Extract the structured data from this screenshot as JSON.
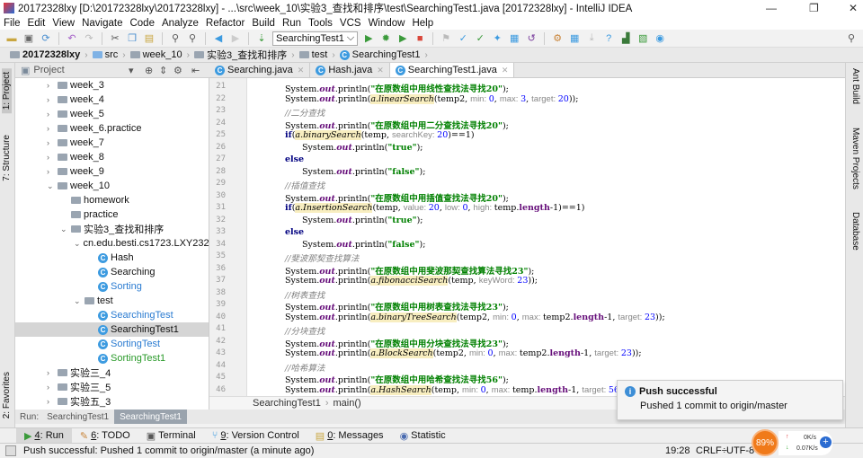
{
  "window": {
    "title": "20172328lxy [D:\\20172328lxy\\20172328lxy] - ...\\src\\week_10\\实验3_查找和排序\\test\\SearchingTest1.java [20172328lxy] - IntelliJ IDEA",
    "minimize": "—",
    "maximize": "❐",
    "close": "✕"
  },
  "menu": [
    "File",
    "Edit",
    "View",
    "Navigate",
    "Code",
    "Analyze",
    "Refactor",
    "Build",
    "Run",
    "Tools",
    "VCS",
    "Window",
    "Help"
  ],
  "toolbar": {
    "run_config": "SearchingTest1",
    "run_config_arrow": "⌵"
  },
  "navbar": [
    "20172328lxy",
    "src",
    "week_10",
    "实验3_查找和排序",
    "test",
    "SearchingTest1"
  ],
  "left_strip": {
    "project": "1: Project",
    "structure": "7: Structure",
    "favorites": "2: Favorites"
  },
  "right_strip": {
    "ant": "Ant Build",
    "maven": "Maven Projects",
    "database": "Database"
  },
  "project_panel": {
    "title": "Project",
    "dropdown": "▾"
  },
  "tree": [
    {
      "label": "week_3",
      "level": 0,
      "type": "folder",
      "arrow": "›"
    },
    {
      "label": "week_4",
      "level": 0,
      "type": "folder",
      "arrow": "›"
    },
    {
      "label": "week_5",
      "level": 0,
      "type": "folder",
      "arrow": "›"
    },
    {
      "label": "week_6.practice",
      "level": 0,
      "type": "folder",
      "arrow": "›"
    },
    {
      "label": "week_7",
      "level": 0,
      "type": "folder",
      "arrow": "›"
    },
    {
      "label": "week_8",
      "level": 0,
      "type": "folder",
      "arrow": "›"
    },
    {
      "label": "week_9",
      "level": 0,
      "type": "folder",
      "arrow": "›"
    },
    {
      "label": "week_10",
      "level": 0,
      "type": "folder",
      "arrow": "⌄"
    },
    {
      "label": "homework",
      "level": 1,
      "type": "folder",
      "arrow": ""
    },
    {
      "label": "practice",
      "level": 1,
      "type": "folder",
      "arrow": ""
    },
    {
      "label": "实验3_查找和排序",
      "level": 1,
      "type": "folder",
      "arrow": "⌄"
    },
    {
      "label": "cn.edu.besti.cs1723.LXY2328",
      "level": 2,
      "type": "folder",
      "arrow": "⌄"
    },
    {
      "label": "Hash",
      "level": 3,
      "type": "class",
      "arrow": ""
    },
    {
      "label": "Searching",
      "level": 3,
      "type": "class",
      "arrow": ""
    },
    {
      "label": "Sorting",
      "level": 3,
      "type": "class",
      "arrow": "",
      "color": "#2a7bd1"
    },
    {
      "label": "test",
      "level": 2,
      "type": "folder",
      "arrow": "⌄"
    },
    {
      "label": "SearchingTest",
      "level": 3,
      "type": "class",
      "arrow": "",
      "color": "#2a7bd1"
    },
    {
      "label": "SearchingTest1",
      "level": 3,
      "type": "class",
      "arrow": "",
      "selected": true
    },
    {
      "label": "SortingTest",
      "level": 3,
      "type": "class",
      "arrow": "",
      "color": "#2a7bd1"
    },
    {
      "label": "SortingTest1",
      "level": 3,
      "type": "class",
      "arrow": "",
      "color": "#2a9a2a"
    },
    {
      "label": "实验三_4",
      "level": -1,
      "type": "folder",
      "arrow": "›"
    },
    {
      "label": "实验三_5",
      "level": -1,
      "type": "folder",
      "arrow": "›"
    },
    {
      "label": "实验五_3",
      "level": -1,
      "type": "folder",
      "arrow": "›"
    }
  ],
  "editor_tabs": [
    {
      "label": "Searching.java",
      "active": false
    },
    {
      "label": "Hash.java",
      "active": false
    },
    {
      "label": "SearchingTest1.java",
      "active": true
    }
  ],
  "code": [
    {
      "n": 21,
      "indent": 0,
      "t": [
        [
          "p",
          "System."
        ],
        [
          "o",
          "out"
        ],
        [
          "p",
          ".println("
        ],
        [
          "s",
          "\"在原数组中用线性查找法寻找20\""
        ],
        [
          "p",
          ");"
        ]
      ]
    },
    {
      "n": 22,
      "indent": 0,
      "t": [
        [
          "p",
          "System."
        ],
        [
          "o",
          "out"
        ],
        [
          "p",
          ".println("
        ],
        [
          "m",
          "a.linearSearch"
        ],
        [
          "p",
          "(temp2, "
        ],
        [
          "h",
          "min: "
        ],
        [
          "n",
          "0"
        ],
        [
          "p",
          ", "
        ],
        [
          "h",
          "max: "
        ],
        [
          "n",
          "3"
        ],
        [
          "p",
          ", "
        ],
        [
          "h",
          "target: "
        ],
        [
          "n",
          "20"
        ],
        [
          "p",
          "));"
        ]
      ]
    },
    {
      "n": 23,
      "indent": 0,
      "t": [
        [
          "c",
          "//二分查找"
        ]
      ]
    },
    {
      "n": 24,
      "indent": 0,
      "t": [
        [
          "p",
          "System."
        ],
        [
          "o",
          "out"
        ],
        [
          "p",
          ".println("
        ],
        [
          "s",
          "\"在原数组中用二分查找法寻找20\""
        ],
        [
          "p",
          ");"
        ]
      ]
    },
    {
      "n": 25,
      "indent": 0,
      "t": [
        [
          "k",
          "if"
        ],
        [
          "p",
          "("
        ],
        [
          "m",
          "a.binarySearch"
        ],
        [
          "p",
          "(temp, "
        ],
        [
          "h",
          "searchKey: "
        ],
        [
          "n",
          "20"
        ],
        [
          "p",
          ")==1)"
        ]
      ]
    },
    {
      "n": 26,
      "indent": 1,
      "t": [
        [
          "p",
          "System."
        ],
        [
          "o",
          "out"
        ],
        [
          "p",
          ".println("
        ],
        [
          "s",
          "\"true\""
        ],
        [
          "p",
          ");"
        ]
      ]
    },
    {
      "n": 27,
      "indent": 0,
      "t": [
        [
          "k",
          "else"
        ]
      ]
    },
    {
      "n": 28,
      "indent": 1,
      "t": [
        [
          "p",
          "System."
        ],
        [
          "o",
          "out"
        ],
        [
          "p",
          ".println("
        ],
        [
          "s",
          "\"false\""
        ],
        [
          "p",
          ");"
        ]
      ]
    },
    {
      "n": 29,
      "indent": 0,
      "t": [
        [
          "c",
          "//插值查找"
        ]
      ]
    },
    {
      "n": 30,
      "indent": 0,
      "t": [
        [
          "p",
          "System."
        ],
        [
          "o",
          "out"
        ],
        [
          "p",
          ".println("
        ],
        [
          "s",
          "\"在原数组中用插值查找法寻找20\""
        ],
        [
          "p",
          ");"
        ]
      ]
    },
    {
      "n": 31,
      "indent": 0,
      "t": [
        [
          "k",
          "if"
        ],
        [
          "p",
          "("
        ],
        [
          "m",
          "a.InsertionSearch"
        ],
        [
          "p",
          "(temp, "
        ],
        [
          "h",
          "value: "
        ],
        [
          "n",
          "20"
        ],
        [
          "p",
          ", "
        ],
        [
          "h",
          "low: "
        ],
        [
          "n",
          "0"
        ],
        [
          "p",
          ", "
        ],
        [
          "h",
          "high: "
        ],
        [
          "p",
          "temp."
        ],
        [
          "f",
          "length"
        ],
        [
          "p",
          "-1)==1)"
        ]
      ]
    },
    {
      "n": 32,
      "indent": 1,
      "t": [
        [
          "p",
          "System."
        ],
        [
          "o",
          "out"
        ],
        [
          "p",
          ".println("
        ],
        [
          "s",
          "\"true\""
        ],
        [
          "p",
          ");"
        ]
      ]
    },
    {
      "n": 33,
      "indent": 0,
      "t": [
        [
          "k",
          "else"
        ]
      ]
    },
    {
      "n": 34,
      "indent": 1,
      "t": [
        [
          "p",
          "System."
        ],
        [
          "o",
          "out"
        ],
        [
          "p",
          ".println("
        ],
        [
          "s",
          "\"false\""
        ],
        [
          "p",
          ");"
        ]
      ]
    },
    {
      "n": 35,
      "indent": 0,
      "t": [
        [
          "c",
          "//斐波那契查找算法"
        ]
      ]
    },
    {
      "n": 36,
      "indent": 0,
      "t": [
        [
          "p",
          "System."
        ],
        [
          "o",
          "out"
        ],
        [
          "p",
          ".println("
        ],
        [
          "s",
          "\"在原数组中用斐波那契查找算法寻找23\""
        ],
        [
          "p",
          ");"
        ]
      ]
    },
    {
      "n": 37,
      "indent": 0,
      "t": [
        [
          "p",
          "System."
        ],
        [
          "o",
          "out"
        ],
        [
          "p",
          ".println("
        ],
        [
          "m",
          "a.fibonacciSearch"
        ],
        [
          "p",
          "(temp, "
        ],
        [
          "h",
          "keyWord: "
        ],
        [
          "n",
          "23"
        ],
        [
          "p",
          "));"
        ]
      ]
    },
    {
      "n": 38,
      "indent": 0,
      "t": [
        [
          "c",
          "//树表查找"
        ]
      ]
    },
    {
      "n": 39,
      "indent": 0,
      "t": [
        [
          "p",
          "System."
        ],
        [
          "o",
          "out"
        ],
        [
          "p",
          ".println("
        ],
        [
          "s",
          "\"在原数组中用树表查找法寻找23\""
        ],
        [
          "p",
          ");"
        ]
      ]
    },
    {
      "n": 40,
      "indent": 0,
      "t": [
        [
          "p",
          "System."
        ],
        [
          "o",
          "out"
        ],
        [
          "p",
          ".println("
        ],
        [
          "m",
          "a.binaryTreeSearch"
        ],
        [
          "p",
          "(temp2, "
        ],
        [
          "h",
          "min: "
        ],
        [
          "n",
          "0"
        ],
        [
          "p",
          ", "
        ],
        [
          "h",
          "max: "
        ],
        [
          "p",
          "temp2."
        ],
        [
          "f",
          "length"
        ],
        [
          "p",
          "-1, "
        ],
        [
          "h",
          "target: "
        ],
        [
          "n",
          "23"
        ],
        [
          "p",
          "));"
        ]
      ]
    },
    {
      "n": 41,
      "indent": 0,
      "t": [
        [
          "c",
          "//分块查找"
        ]
      ]
    },
    {
      "n": 42,
      "indent": 0,
      "t": [
        [
          "p",
          "System."
        ],
        [
          "o",
          "out"
        ],
        [
          "p",
          ".println("
        ],
        [
          "s",
          "\"在原数组中用分块查找法寻找23\""
        ],
        [
          "p",
          ");"
        ]
      ]
    },
    {
      "n": 43,
      "indent": 0,
      "t": [
        [
          "p",
          "System."
        ],
        [
          "o",
          "out"
        ],
        [
          "p",
          ".println("
        ],
        [
          "m",
          "a.BlockSearch"
        ],
        [
          "p",
          "(temp2, "
        ],
        [
          "h",
          "min: "
        ],
        [
          "n",
          "0"
        ],
        [
          "p",
          ", "
        ],
        [
          "h",
          "max: "
        ],
        [
          "p",
          "temp2."
        ],
        [
          "f",
          "length"
        ],
        [
          "p",
          "-1, "
        ],
        [
          "h",
          "target: "
        ],
        [
          "n",
          "23"
        ],
        [
          "p",
          "));"
        ]
      ]
    },
    {
      "n": 44,
      "indent": 0,
      "t": [
        [
          "c",
          "//哈希算法"
        ]
      ]
    },
    {
      "n": 45,
      "indent": 0,
      "t": [
        [
          "p",
          "System."
        ],
        [
          "o",
          "out"
        ],
        [
          "p",
          ".println("
        ],
        [
          "s",
          "\"在原数组中用哈希查找法寻找56\""
        ],
        [
          "p",
          ");"
        ]
      ]
    },
    {
      "n": 46,
      "indent": 0,
      "t": [
        [
          "p",
          "System."
        ],
        [
          "o",
          "out"
        ],
        [
          "p",
          ".println("
        ],
        [
          "m",
          "a.HashSearch"
        ],
        [
          "p",
          "(temp, "
        ],
        [
          "h",
          "min: "
        ],
        [
          "n",
          "0"
        ],
        [
          "p",
          ", "
        ],
        [
          "h",
          "max: "
        ],
        [
          "p",
          "temp."
        ],
        [
          "f",
          "length"
        ],
        [
          "p",
          "-1, "
        ],
        [
          "h",
          "target: "
        ],
        [
          "n",
          "56"
        ],
        [
          "p",
          "));"
        ]
      ]
    }
  ],
  "editor_breadcrumb": {
    "class": "SearchingTest1",
    "sep": "›",
    "method": "main()"
  },
  "run_bar": {
    "label": "Run:",
    "tabs": [
      "SearchingTest1",
      "SearchingTest1"
    ]
  },
  "tool_windows": [
    {
      "key": "4",
      "label": ": Run",
      "active": true
    },
    {
      "key": "6",
      "label": ": TODO"
    },
    {
      "key": "",
      "label": "Terminal"
    },
    {
      "key": "9",
      "label": ": Version Control"
    },
    {
      "key": "0",
      "label": ": Messages"
    },
    {
      "key": "",
      "label": "Statistic"
    }
  ],
  "status": {
    "message": "Push successful: Pushed 1 commit to origin/master (a minute ago)",
    "position": "19:28",
    "line_sep": "CRLF÷",
    "encoding": "UTF-8÷"
  },
  "notification": {
    "title": "Push successful",
    "body": "Pushed 1 commit to origin/master"
  },
  "widget": {
    "percent": "89%",
    "up": "0K/s",
    "down": "0.07K/s"
  },
  "colors": {
    "accent": "#3d8ed6",
    "widget": "#f07a1a",
    "selection": "#d5d5d5"
  }
}
